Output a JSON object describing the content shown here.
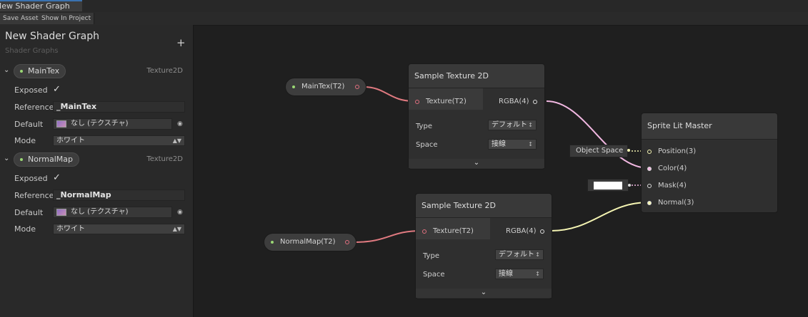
{
  "window": {
    "tab_title": "New Shader Graph"
  },
  "toolbar": {
    "save_asset": "Save Asset",
    "show_in_project": "Show In Project"
  },
  "blackboard": {
    "title": "New Shader Graph",
    "subtitle": "Shader Graphs",
    "add_symbol": "+",
    "properties": [
      {
        "name": "MainTex",
        "type": "Texture2D",
        "exposed_label": "Exposed",
        "exposed": true,
        "reference_label": "Reference",
        "reference": "_MainTex",
        "default_label": "Default",
        "default": "なし (テクスチャ)",
        "mode_label": "Mode",
        "mode": "ホワイト"
      },
      {
        "name": "NormalMap",
        "type": "Texture2D",
        "exposed_label": "Exposed",
        "exposed": true,
        "reference_label": "Reference",
        "reference": "_NormalMap",
        "default_label": "Default",
        "default": "なし (テクスチャ)",
        "mode_label": "Mode",
        "mode": "ホワイト"
      }
    ]
  },
  "nodes": {
    "maintex_prop": {
      "label": "MainTex(T2)"
    },
    "normalmap_prop": {
      "label": "NormalMap(T2)"
    },
    "sample1": {
      "title": "Sample Texture 2D",
      "input": "Texture(T2)",
      "output": "RGBA(4)",
      "type_label": "Type",
      "type_value": "デフォルト",
      "space_label": "Space",
      "space_value": "接線"
    },
    "sample2": {
      "title": "Sample Texture 2D",
      "input": "Texture(T2)",
      "output": "RGBA(4)",
      "type_label": "Type",
      "type_value": "デフォルト",
      "space_label": "Space",
      "space_value": "接線"
    },
    "master": {
      "title": "Sprite Lit Master",
      "ports": [
        "Position(3)",
        "Color(4)",
        "Mask(4)",
        "Normal(3)"
      ],
      "position_input": "Object Space"
    }
  },
  "colors": {
    "texture_wire": "#e07a80",
    "vector4_wire": "#f2b8e2",
    "vector3_wire": "#f5f5b3",
    "property_dot": "#9ad774",
    "selected_tab": "#3a72b0"
  },
  "icons": [
    "expand-chevron-icon",
    "collapse-chevron-icon",
    "checkbox-check-icon",
    "dropdown-arrow-icon",
    "object-picker-icon",
    "plus-icon"
  ]
}
